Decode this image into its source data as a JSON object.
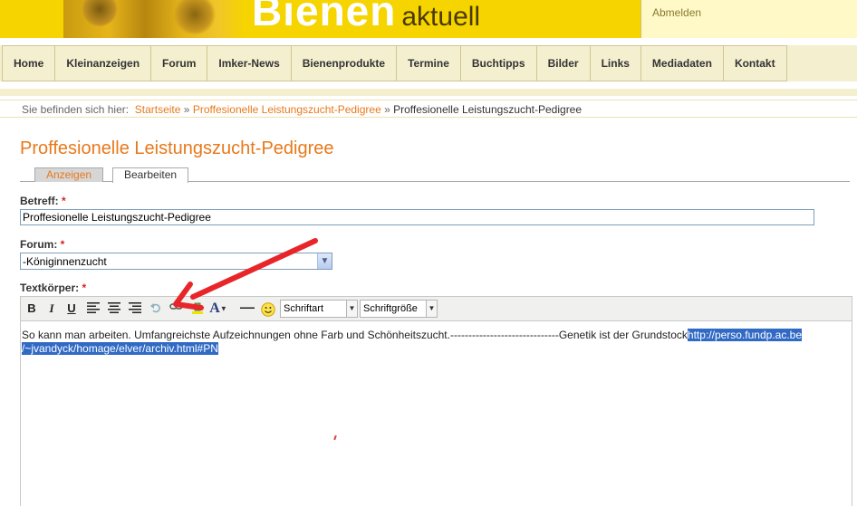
{
  "header": {
    "logo_big": "Bienen",
    "logo_small": "aktuell",
    "logout_label": "Abmelden"
  },
  "nav": {
    "items": [
      {
        "label": "Home"
      },
      {
        "label": "Kleinanzeigen"
      },
      {
        "label": "Forum"
      },
      {
        "label": "Imker-News"
      },
      {
        "label": "Bienenprodukte"
      },
      {
        "label": "Termine"
      },
      {
        "label": "Buchtipps"
      },
      {
        "label": "Bilder"
      },
      {
        "label": "Links"
      },
      {
        "label": "Mediadaten"
      },
      {
        "label": "Kontakt"
      }
    ]
  },
  "breadcrumb": {
    "prefix": "Sie befinden sich hier:",
    "links": [
      "Startseite",
      "Proffesionelle Leistungszucht-Pedigree"
    ],
    "separator": "»",
    "current": "Proffesionelle Leistungszucht-Pedigree"
  },
  "page": {
    "title": "Proffesionelle Leistungszucht-Pedigree",
    "tabs": [
      {
        "label": "Anzeigen"
      },
      {
        "label": "Bearbeiten"
      }
    ]
  },
  "form": {
    "required_mark": "*",
    "subject_label": "Betreff:",
    "subject_value": "Proffesionelle Leistungszucht-Pedigree",
    "forum_label": "Forum:",
    "forum_value": "-Königinnenzucht",
    "body_label": "Textkörper:"
  },
  "editor": {
    "font_family_label": "Schriftart",
    "font_size_label": "Schriftgröße",
    "toolbar_icons": [
      "bold-icon",
      "italic-icon",
      "underline-icon",
      "align-left-icon",
      "align-center-icon",
      "align-right-icon",
      "undo-icon",
      "link-icon",
      "highlight-icon",
      "font-color-icon",
      "horizontal-rule-icon",
      "emoticon-icon"
    ],
    "content_text": "So kann man arbeiten. Umfangreichste Aufzeichnungen ohne Farb und Schönheitszucht.------------------------------Genetik ist der Grundstock",
    "content_link_line1": "http://perso.fundp.ac.be",
    "content_link_line2": "/~jvandyck/homage/elver/archiv.html#PN"
  },
  "colors": {
    "brand_yellow": "#f6d400",
    "accent_orange": "#e8791b",
    "nav_bg": "#f4efcf",
    "selection_blue": "#316ac5",
    "annotation_red": "#e8262a"
  }
}
